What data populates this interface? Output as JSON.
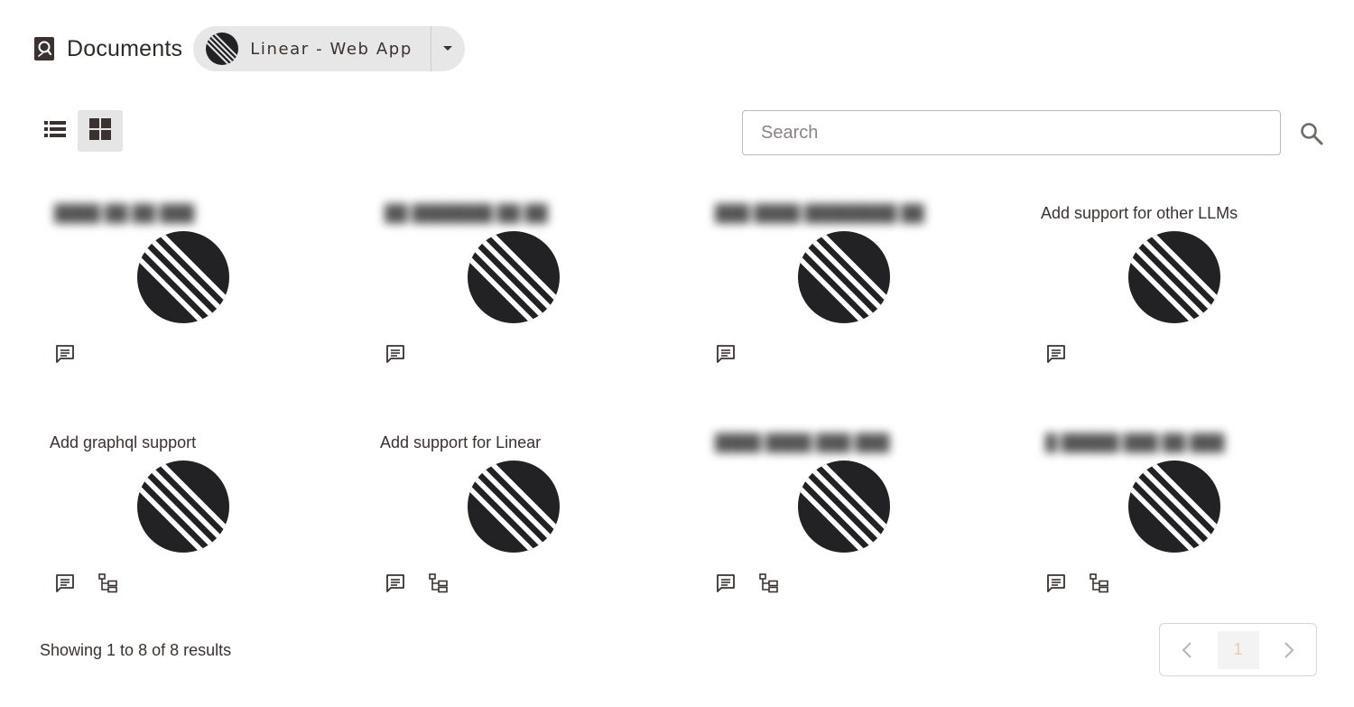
{
  "header": {
    "title": "Documents",
    "title_icon": "document-icon",
    "project": {
      "label": "Linear - Web App",
      "logo": "linear-logo",
      "caret": "caret-down-icon"
    }
  },
  "toolbar": {
    "view_list_icon": "list-view-icon",
    "view_grid_icon": "grid-view-icon",
    "active_view": "grid",
    "search_placeholder": "Search",
    "search_value": "",
    "search_icon": "search-icon"
  },
  "cards": [
    {
      "title": "████ ██ ██ ███",
      "blurred": true,
      "icons": [
        "comment-icon"
      ]
    },
    {
      "title": "██ ███████ ██ ██",
      "blurred": true,
      "icons": [
        "comment-icon"
      ]
    },
    {
      "title": "███ ████ ████████ ██",
      "blurred": true,
      "icons": [
        "comment-icon"
      ]
    },
    {
      "title": "Add support for other LLMs",
      "blurred": false,
      "icons": [
        "comment-icon"
      ]
    },
    {
      "title": "Add graphql support",
      "blurred": false,
      "icons": [
        "comment-icon",
        "hierarchy-icon"
      ]
    },
    {
      "title": "Add support for Linear",
      "blurred": false,
      "icons": [
        "comment-icon",
        "hierarchy-icon"
      ]
    },
    {
      "title": "████ ████ ███ ███",
      "blurred": true,
      "icons": [
        "comment-icon",
        "hierarchy-icon"
      ]
    },
    {
      "title": "█ █████ ███ ██ ███",
      "blurred": true,
      "icons": [
        "comment-icon",
        "hierarchy-icon"
      ]
    }
  ],
  "footer": {
    "results_text": "Showing 1 to 8 of 8 results",
    "current_page": "1",
    "prev_icon": "chevron-left-icon",
    "next_icon": "chevron-right-icon"
  },
  "colors": {
    "text": "#3a3230",
    "logo": "#222225",
    "pill_bg": "#e8e7e7",
    "active_toggle_bg": "#e6e5e5",
    "page_number": "#f1c9a4"
  }
}
